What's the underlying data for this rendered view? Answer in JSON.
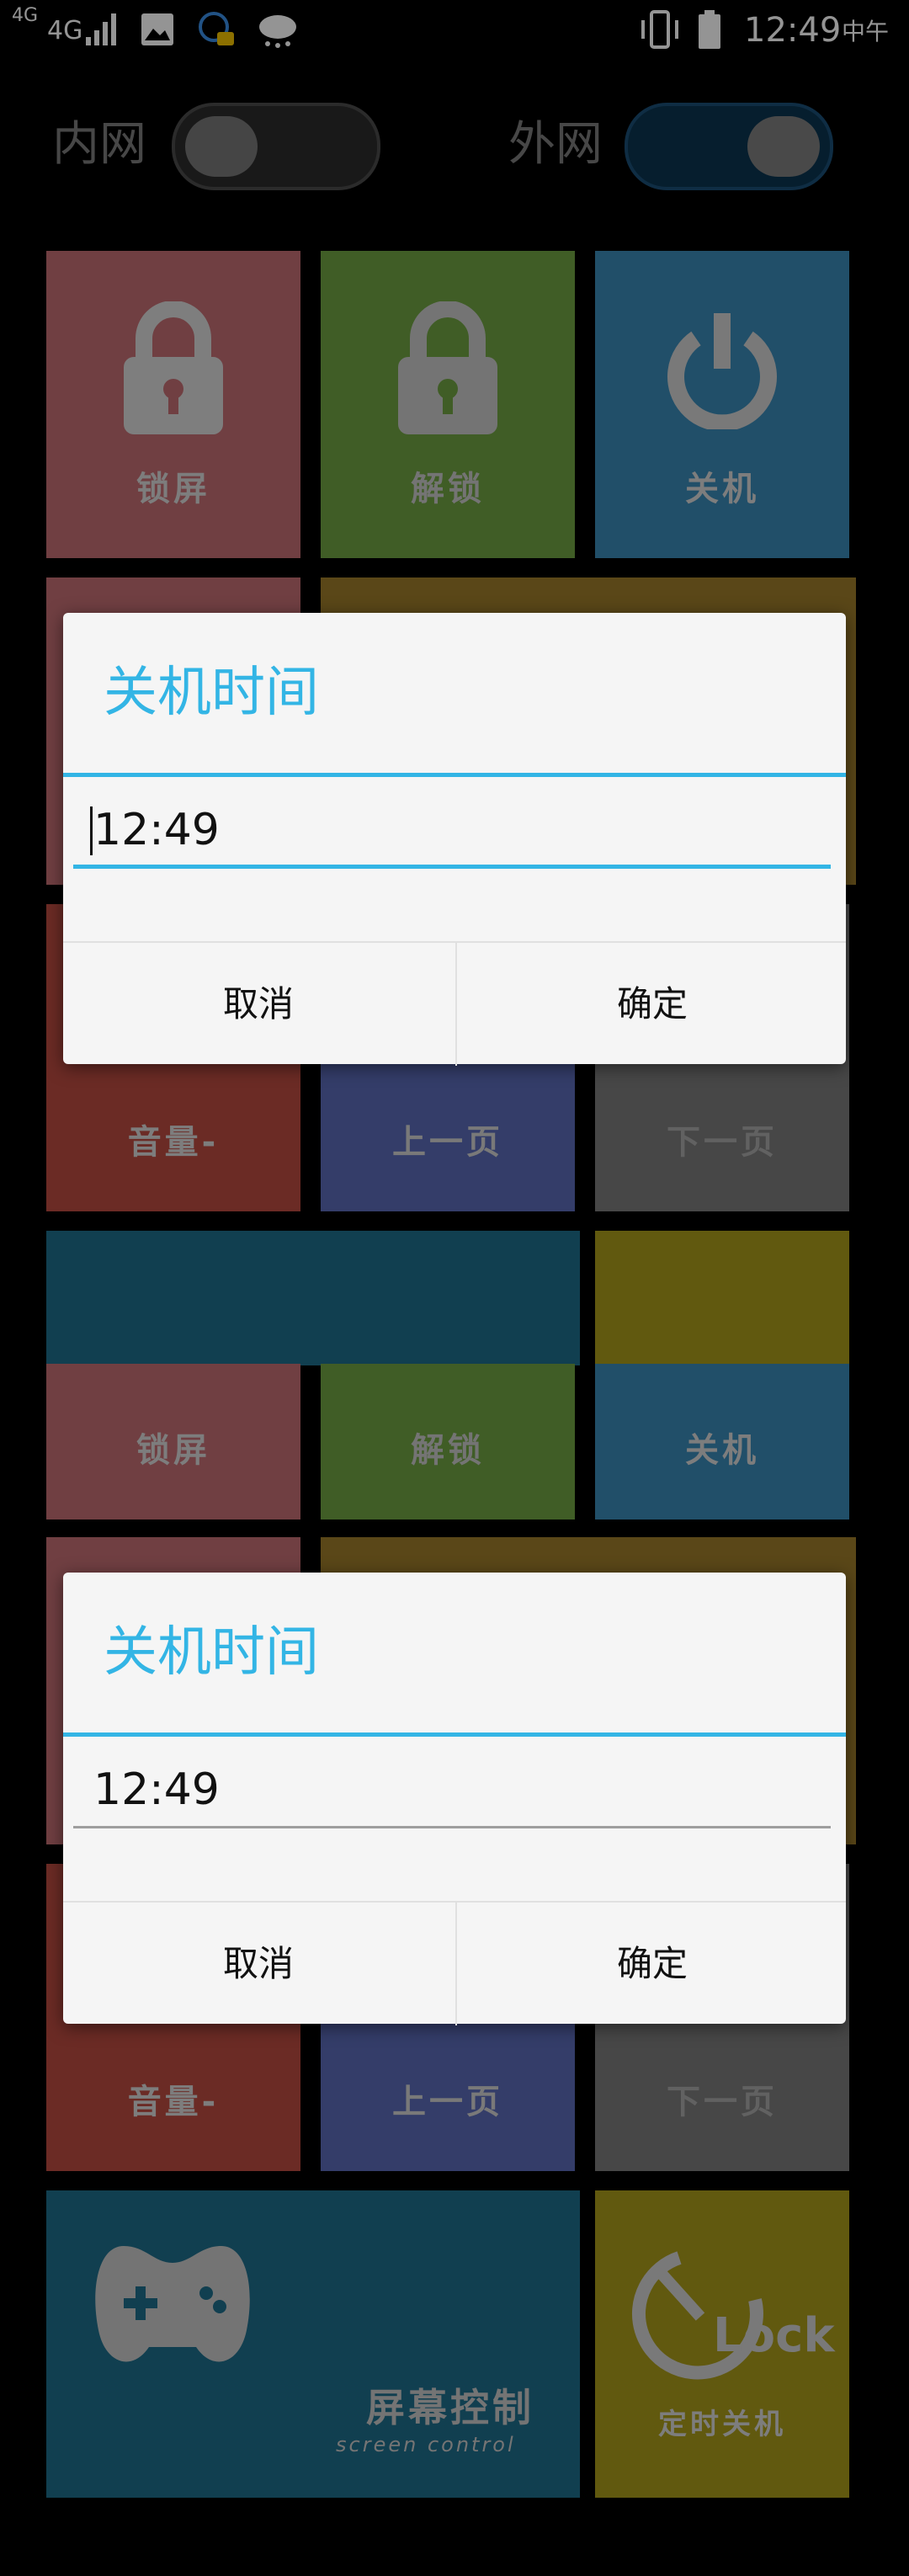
{
  "status_bar": {
    "network_label": "4G",
    "network_label2": "4G",
    "time": "12:49",
    "ampm": "中午",
    "icons": [
      "signal-icon",
      "image-icon",
      "notification-bell-icon",
      "cloud-icon",
      "vibrate-icon",
      "battery-icon"
    ]
  },
  "toggles": {
    "intranet_label": "内网",
    "intranet_on": false,
    "internet_label": "外网",
    "internet_on": true
  },
  "tiles": {
    "lock": "锁屏",
    "unlock": "解锁",
    "shutdown": "关机",
    "volume_down": "音量-",
    "prev_page": "上一页",
    "next_page": "下一页",
    "screen_control": "屏幕控制",
    "screen_control_sub": "screen control",
    "timed_shutdown": "定时关机",
    "lock_word": "Lock"
  },
  "dialog_top": {
    "title": "关机时间",
    "value": "12:49",
    "cancel": "取消",
    "confirm": "确定"
  },
  "dialog_bottom": {
    "title": "关机时间",
    "value": "12:49",
    "cancel": "取消",
    "confirm": "确定"
  },
  "colors": {
    "accent": "#33b5e5",
    "tile_pink": "#c16d72",
    "tile_green": "#6ea142",
    "tile_blue": "#3a89b5",
    "tile_red": "#b84a40",
    "tile_indigo": "#5a6ab6",
    "tile_gray": "#7a7a7a",
    "tile_olive": "#9c7a2a",
    "tile_teal": "#1e6d8a",
    "tile_yellow": "#a89a1a"
  }
}
